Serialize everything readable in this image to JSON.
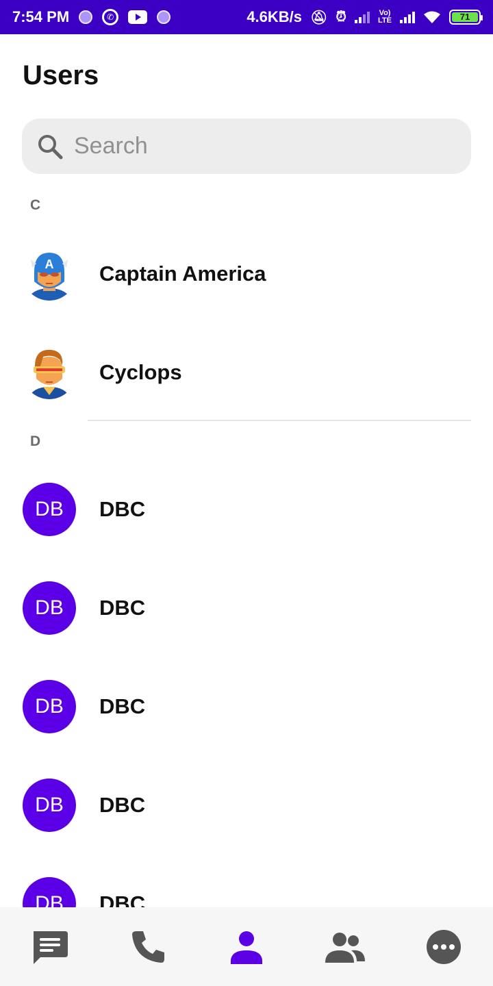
{
  "status_bar": {
    "time": "7:54 PM",
    "network_speed": "4.6KB/s",
    "lte_label": "LTE",
    "volte_label": "Vo)",
    "battery_level": "71",
    "bg_color": "#3b00c4",
    "icons": [
      "purple-dot-icon",
      "whatsapp-icon",
      "youtube-icon",
      "purple-dot-icon",
      "muted-bell-icon",
      "alarm-icon",
      "signal-icon",
      "signal-icon",
      "wifi-icon",
      "battery-icon"
    ]
  },
  "header": {
    "title": "Users"
  },
  "search": {
    "placeholder": "Search",
    "value": ""
  },
  "sections": [
    {
      "letter": "C",
      "users": [
        {
          "name": "Captain America",
          "avatar": "captain-america-avatar"
        },
        {
          "name": "Cyclops",
          "avatar": "cyclops-avatar"
        }
      ]
    },
    {
      "letter": "D",
      "users": [
        {
          "name": "DBC",
          "initials": "DB"
        },
        {
          "name": "DBC",
          "initials": "DB"
        },
        {
          "name": "DBC",
          "initials": "DB"
        },
        {
          "name": "DBC",
          "initials": "DB"
        },
        {
          "name": "DBC",
          "initials": "DB"
        }
      ]
    }
  ],
  "bottom_nav": {
    "items": [
      {
        "name": "chats",
        "icon": "chat-bubble-icon",
        "active": false
      },
      {
        "name": "calls",
        "icon": "phone-icon",
        "active": false
      },
      {
        "name": "users",
        "icon": "person-icon",
        "active": true
      },
      {
        "name": "groups",
        "icon": "group-icon",
        "active": false
      },
      {
        "name": "more",
        "icon": "more-icon",
        "active": false
      }
    ]
  },
  "colors": {
    "accent": "#5b00e6",
    "inactive_icon": "#555555",
    "section_header": "#6b6b6b"
  }
}
